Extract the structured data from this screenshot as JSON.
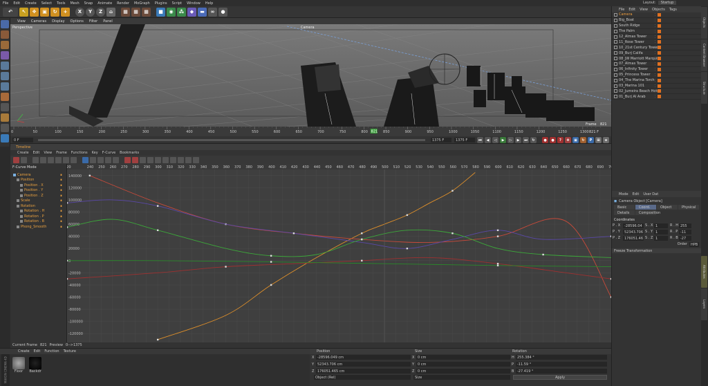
{
  "menu": [
    "File",
    "Edit",
    "Create",
    "Select",
    "Tools",
    "Mesh",
    "Snap",
    "Animate",
    "Render",
    "MoGraph",
    "Plugins",
    "Script",
    "Window",
    "Help"
  ],
  "layout": {
    "label": "Layout:",
    "value": "Startup"
  },
  "toolbar_axes": [
    "X",
    "Y",
    "Z"
  ],
  "viewport": {
    "menu": [
      "View",
      "Cameras",
      "Display",
      "Options",
      "Filter",
      "Panel"
    ],
    "label": "Perspective",
    "camera_label": "Camera",
    "frame_label": "Frame",
    "frame_value": "821"
  },
  "ruler": {
    "ticks": [
      "0",
      "50",
      "100",
      "150",
      "200",
      "250",
      "300",
      "350",
      "400",
      "450",
      "500",
      "550",
      "600",
      "650",
      "700",
      "750",
      "800",
      "850",
      "900",
      "950",
      "1000",
      "1050",
      "1100",
      "1150",
      "1200",
      "1250",
      "1300",
      "1350"
    ],
    "current": "821",
    "end_field": "821 F"
  },
  "playback": {
    "start": "0 F",
    "end1": "1375 F",
    "end2": "1375 F"
  },
  "timeline": {
    "title": "Timeline",
    "menu": [
      "Create",
      "Edit",
      "View",
      "Frame",
      "Functions",
      "Key",
      "F-Curve",
      "Bookmarks"
    ],
    "mode": "F-Curve Mode",
    "tracks": [
      {
        "label": "Camera",
        "indent": 0,
        "color": "#e8a040"
      },
      {
        "label": "Position",
        "indent": 1,
        "color": "#e8a040"
      },
      {
        "label": "Position . X",
        "indent": 2,
        "color": "#e8a040"
      },
      {
        "label": "Position . Y",
        "indent": 2,
        "color": "#e8a040"
      },
      {
        "label": "Position . Z",
        "indent": 2,
        "color": "#e8a040"
      },
      {
        "label": "Scale",
        "indent": 1,
        "color": "#e8a040"
      },
      {
        "label": "Rotation",
        "indent": 1,
        "color": "#e8a040"
      },
      {
        "label": "Rotation . H",
        "indent": 2,
        "color": "#e8a040"
      },
      {
        "label": "Rotation . P",
        "indent": 2,
        "color": "#e8a040"
      },
      {
        "label": "Rotation . B",
        "indent": 2,
        "color": "#e8a040"
      },
      {
        "label": "Phong_Smooth",
        "indent": 1,
        "color": "#e8a040"
      }
    ],
    "top_ticks": [
      "220",
      "240",
      "250",
      "260",
      "270",
      "280",
      "290",
      "300",
      "310",
      "320",
      "330",
      "340",
      "350",
      "360",
      "370",
      "380",
      "390",
      "400",
      "410",
      "420",
      "430",
      "440",
      "450",
      "460",
      "470",
      "480",
      "490",
      "500",
      "510",
      "520",
      "530",
      "540",
      "550",
      "560",
      "570",
      "580",
      "590",
      "600",
      "610",
      "620",
      "630",
      "640",
      "650",
      "660",
      "670",
      "680",
      "690",
      "700"
    ],
    "y_ticks": [
      "140000",
      "120000",
      "100000",
      "80000",
      "60000",
      "40000",
      "20000",
      "0",
      "-20000",
      "-40000",
      "-60000",
      "-80000",
      "-100000",
      "-120000"
    ],
    "status": {
      "current_frame_label": "Current Frame",
      "current_frame": "821",
      "preview_label": "Preview",
      "preview": "0-->1375"
    }
  },
  "materials": {
    "menu": [
      "Create",
      "Edit",
      "Function",
      "Texture"
    ],
    "items": [
      {
        "name": "Floor"
      },
      {
        "name": "Backdr"
      }
    ],
    "brand": "MAXON CINEMA 4D"
  },
  "coordinates": {
    "headers": [
      "Position",
      "Size",
      "Rotation"
    ],
    "rows": [
      {
        "axis": "X",
        "pos": "-28596.049 cm",
        "size_axis": "X",
        "size": "0 cm",
        "rot_axis": "H",
        "rot": "255.384 °"
      },
      {
        "axis": "Y",
        "pos": "52343.706 cm",
        "size_axis": "Y",
        "size": "0 cm",
        "rot_axis": "P",
        "rot": "-11.59 °"
      },
      {
        "axis": "Z",
        "pos": "176051.465 cm",
        "size_axis": "Z",
        "size": "0 cm",
        "rot_axis": "B",
        "rot": "-27.419 °"
      }
    ],
    "mode": "Object (Rel)",
    "size_mode": "Size",
    "apply": "Apply"
  },
  "objects": {
    "menu": [
      "File",
      "Edit",
      "View",
      "Objects",
      "Tags"
    ],
    "items": [
      "Camera",
      "Big_Boat",
      "South Ridge",
      "The Palm",
      "12_Almas Tower",
      "11_Rose Tower",
      "10_21st Century Tower",
      "09_Burj Califa",
      "08_JW Marriott Marquis",
      "07_Almas Tower",
      "06_Infinity Tower",
      "05_Princess Tower",
      "04_The Marina Torch",
      "03_Marina 101",
      "02_Jumeira Beach Hote",
      "01_Burj Al Arab"
    ]
  },
  "attributes": {
    "menu": [
      "Mode",
      "Edit",
      "User Dat"
    ],
    "title": "Camera Object [Camera]",
    "tabs1": [
      "Basic",
      "Coord.",
      "Object",
      "Physical"
    ],
    "tabs2": [
      "Details",
      "Composition"
    ],
    "section": "Coordinates",
    "rows": [
      {
        "a": "P . X",
        "v": "-28596.04",
        "b": "S . X",
        "s": "1",
        "c": "R . H",
        "r": "255"
      },
      {
        "a": "P . Y",
        "v": "52343.706",
        "b": "S . Y",
        "s": "1",
        "c": "R . P",
        "r": "-11"
      },
      {
        "a": "P . Z",
        "v": "176051.46",
        "b": "S . Z",
        "s": "1",
        "c": "R . B",
        "r": "-27"
      }
    ],
    "order_label": "Order",
    "order_value": "HPB",
    "freeze": "Freeze Transformation"
  },
  "side_tabs": [
    "Objects",
    "Content Browser",
    "Structure",
    "Attributes",
    "Layers"
  ],
  "chart_data": {
    "type": "line",
    "title": "",
    "xlabel": "",
    "ylabel": "",
    "xlim": [
      220,
      700
    ],
    "ylim": [
      -130000,
      150000
    ],
    "series": [
      {
        "color": "#e0902a",
        "x": [
          300,
          360,
          400,
          440,
          480,
          500,
          520,
          540,
          560,
          580
        ],
        "y": [
          -130000,
          -90000,
          -40000,
          5000,
          45000,
          60000,
          75000,
          95000,
          115000,
          145000
        ]
      },
      {
        "color": "#c84a3a",
        "x": [
          240,
          300,
          360,
          420,
          480,
          540,
          600,
          660,
          700
        ],
        "y": [
          140000,
          95000,
          60000,
          45000,
          35000,
          30000,
          40000,
          65000,
          -60000
        ]
      },
      {
        "color": "#5a48a8",
        "x": [
          220,
          260,
          300,
          360,
          420,
          480,
          520,
          560,
          600,
          640,
          700
        ],
        "y": [
          95000,
          100000,
          90000,
          60000,
          45000,
          30000,
          20000,
          35000,
          50000,
          35000,
          40000
        ]
      },
      {
        "color": "#3ca83a",
        "x": [
          220,
          260,
          300,
          360,
          400,
          440,
          480,
          520,
          560,
          600,
          640,
          700
        ],
        "y": [
          55000,
          68000,
          50000,
          20000,
          8000,
          10000,
          35000,
          50000,
          45000,
          20000,
          10000,
          5000
        ]
      },
      {
        "color": "#a03030",
        "x": [
          220,
          300,
          360,
          420,
          480,
          540,
          600,
          660,
          700
        ],
        "y": [
          -30000,
          -20000,
          -10000,
          -5000,
          0,
          5000,
          -5000,
          -20000,
          -30000
        ]
      },
      {
        "color": "#2a8a2a",
        "x": [
          220,
          300,
          400,
          500,
          600,
          700
        ],
        "y": [
          0,
          0,
          -2000,
          -5000,
          -8000,
          -10000
        ]
      }
    ]
  }
}
